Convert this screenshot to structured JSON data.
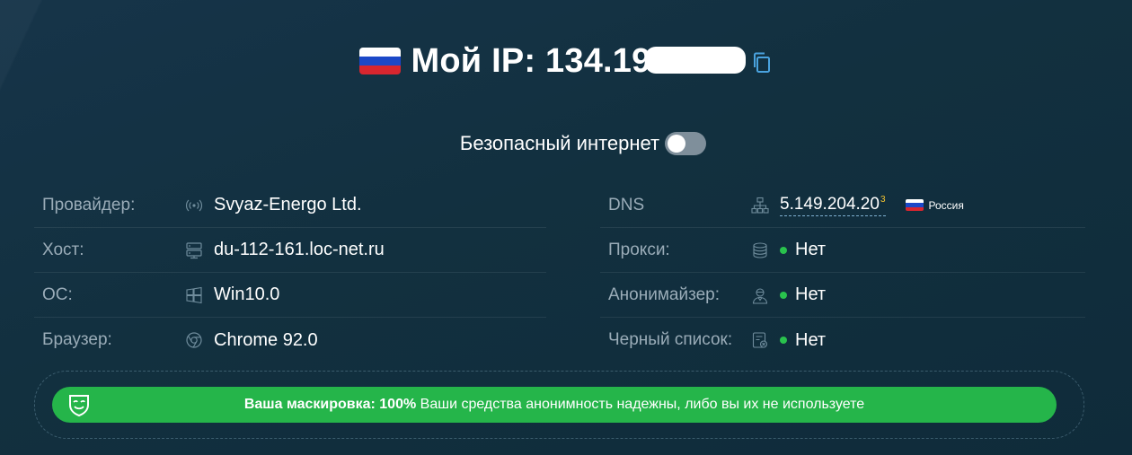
{
  "header": {
    "flag_icon": "russia-flag-icon",
    "ip_label": "Мой IP: 134.19",
    "ip_masked": "(redacted)",
    "copy_icon": "copy-icon"
  },
  "safe_internet": {
    "label": "Безопасный интернет",
    "enabled": false
  },
  "left_info": [
    {
      "label": "Провайдер:",
      "icon": "signal-icon",
      "value": "Svyaz-Energo Ltd."
    },
    {
      "label": "Хост:",
      "icon": "server-icon",
      "value": "du-112-161.loc-net.ru"
    },
    {
      "label": "ОС:",
      "icon": "windows-icon",
      "value": "Win10.0"
    },
    {
      "label": "Браузер:",
      "icon": "chrome-icon",
      "value": "Chrome 92.0"
    }
  ],
  "right_info": [
    {
      "label": "DNS",
      "icon": "network-icon",
      "value": "5.149.204.20",
      "sup": "3",
      "country": "Россия"
    },
    {
      "label": "Прокси:",
      "icon": "database-icon",
      "value": "Нет",
      "status_color": "#29c24d"
    },
    {
      "label": "Анонимайзер:",
      "icon": "anonymous-user-icon",
      "value": "Нет",
      "status_color": "#29c24d"
    },
    {
      "label": "Черный список:",
      "icon": "blacklist-icon",
      "value": "Нет",
      "status_color": "#29c24d"
    }
  ],
  "masking": {
    "icon": "mask-icon",
    "title": "Ваша маскировка: 100%",
    "text": "Ваши средства анонимность надежны, либо вы их не используете",
    "accent": "#25b54a"
  }
}
